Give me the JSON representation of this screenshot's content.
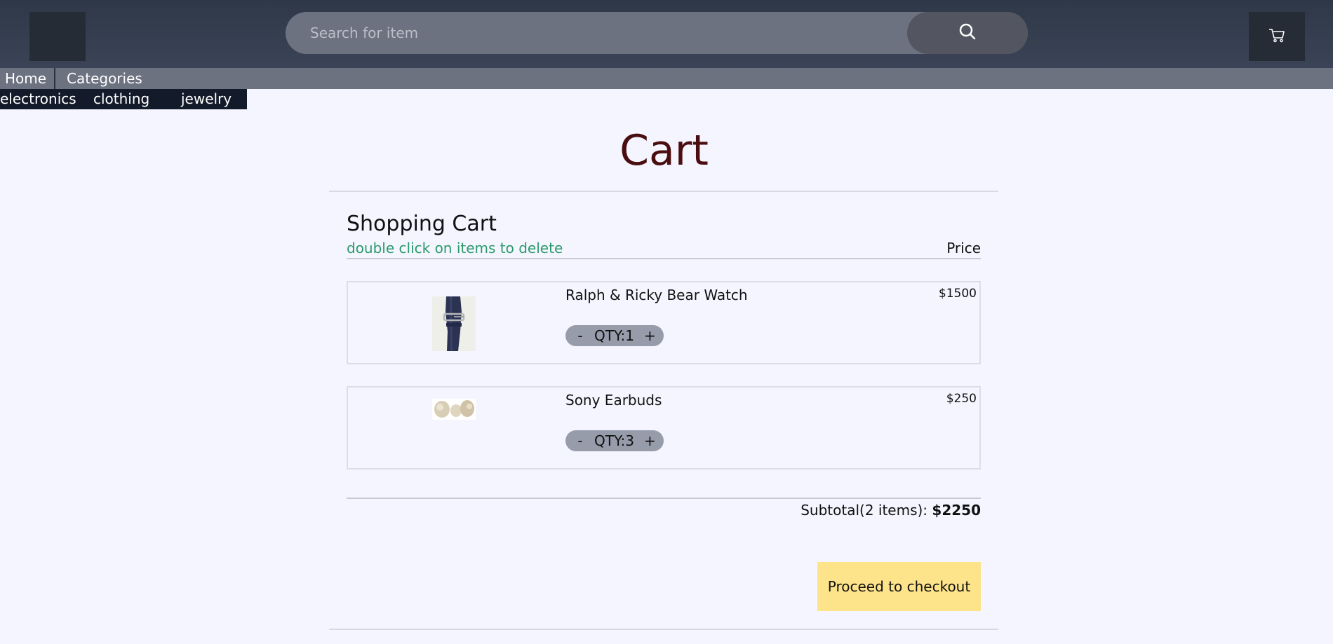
{
  "header": {
    "search": {
      "placeholder": "Search for item"
    },
    "icons": {
      "search": "search-icon",
      "cart": "cart-icon"
    }
  },
  "nav": {
    "home": "Home",
    "categories": "Categories",
    "subcategories": [
      "electronics",
      "clothing",
      "jewelry"
    ]
  },
  "main": {
    "title": "Cart",
    "heading": "Shopping Cart",
    "hint": "double click on items to delete",
    "price_label": "Price",
    "items": [
      {
        "name": "Ralph & Ricky Bear Watch",
        "price": "$1500",
        "qty_text": "QTY:1",
        "minus": "-",
        "plus": "+",
        "image": "watch-image"
      },
      {
        "name": "Sony Earbuds",
        "price": "$250",
        "qty_text": "QTY:3",
        "minus": "-",
        "plus": "+",
        "image": "earbuds-image"
      }
    ],
    "subtotal_label": "Subtotal(2 items): ",
    "subtotal_value": "$2250",
    "checkout_label": "Proceed to checkout"
  },
  "colors": {
    "header_bg": "#2f3848",
    "nav_bg": "#6c7280",
    "subnav_bg": "#131a2a",
    "title": "#4a0e10",
    "hint": "#2a9a6a",
    "checkout_bg": "#fde38a",
    "qty_bg": "#979cab",
    "page_bg": "#f5f5ff"
  }
}
